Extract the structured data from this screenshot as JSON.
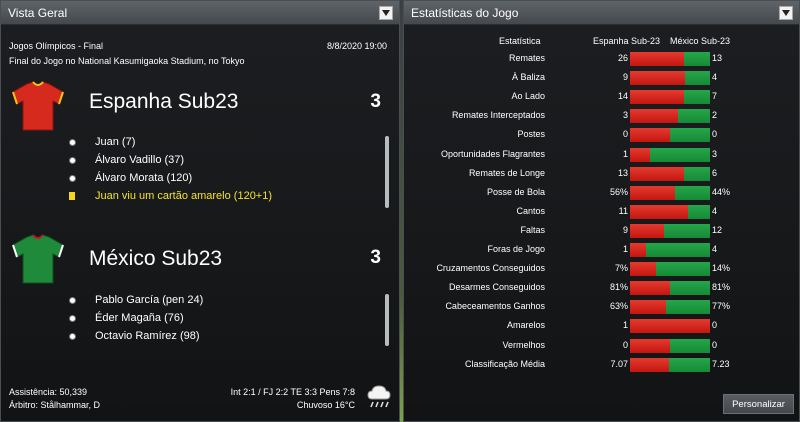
{
  "left_panel": {
    "title": "Vista Geral",
    "competition": "Jogos Olímpicos - Final",
    "date": "8/8/2020 19:00",
    "venue": "Final do Jogo no National Kasumigaoka Stadium, no Tokyo",
    "home": {
      "name": "Espanha Sub23",
      "score": "3",
      "kit_colors": {
        "primary": "#d62a1e",
        "secondary": "#f0c419"
      },
      "events": [
        {
          "type": "goal",
          "text": "Juan (7)"
        },
        {
          "type": "goal",
          "text": "Álvaro Vadillo (37)"
        },
        {
          "type": "goal",
          "text": "Álvaro Morata (120)"
        },
        {
          "type": "yellow-card",
          "text": "Juan viu um cartão amarelo (120+1)"
        }
      ]
    },
    "away": {
      "name": "México Sub23",
      "score": "3",
      "kit_colors": {
        "primary": "#1f8a3a",
        "secondary": "#c8102e"
      },
      "events": [
        {
          "type": "goal",
          "text": "Pablo García (pen 24)"
        },
        {
          "type": "goal",
          "text": "Éder Magaña (76)"
        },
        {
          "type": "goal",
          "text": "Octavio Ramírez (98)"
        }
      ]
    },
    "attendance": "Assistência: 50,339",
    "referee": "Árbitro: Stålhammar, D",
    "score_summary": "Int 2:1 / FJ 2:2 TE 3:3 Pens 7:8",
    "weather": "Chuvoso 16°C",
    "weather_icon": "rain-cloud-icon"
  },
  "right_panel": {
    "title": "Estatísticas do Jogo",
    "col_stat": "Estatística",
    "col_home": "Espanha Sub-23",
    "col_away": "México Sub-23",
    "colors": {
      "home": "#d32018",
      "away": "#1f9a44"
    },
    "stats": [
      {
        "label": "Remates",
        "home": "26",
        "away": "13",
        "home_share": 0.67
      },
      {
        "label": "À Baliza",
        "home": "9",
        "away": "4",
        "home_share": 0.69
      },
      {
        "label": "Ao Lado",
        "home": "14",
        "away": "7",
        "home_share": 0.67
      },
      {
        "label": "Remates Interceptados",
        "home": "3",
        "away": "2",
        "home_share": 0.6
      },
      {
        "label": "Postes",
        "home": "0",
        "away": "0",
        "home_share": 0.5
      },
      {
        "label": "Oportunidades Flagrantes",
        "home": "1",
        "away": "3",
        "home_share": 0.25
      },
      {
        "label": "Remates de Longe",
        "home": "13",
        "away": "6",
        "home_share": 0.68
      },
      {
        "label": "Posse de Bola",
        "home": "56%",
        "away": "44%",
        "home_share": 0.56
      },
      {
        "label": "Cantos",
        "home": "11",
        "away": "4",
        "home_share": 0.73
      },
      {
        "label": "Faltas",
        "home": "9",
        "away": "12",
        "home_share": 0.43
      },
      {
        "label": "Foras de Jogo",
        "home": "1",
        "away": "4",
        "home_share": 0.2
      },
      {
        "label": "Cruzamentos Conseguidos",
        "home": "7%",
        "away": "14%",
        "home_share": 0.33
      },
      {
        "label": "Desarmes Conseguidos",
        "home": "81%",
        "away": "81%",
        "home_share": 0.5
      },
      {
        "label": "Cabeceamentos Ganhos",
        "home": "63%",
        "away": "77%",
        "home_share": 0.45
      },
      {
        "label": "Amarelos",
        "home": "1",
        "away": "0",
        "home_share": 1.0
      },
      {
        "label": "Vermelhos",
        "home": "0",
        "away": "0",
        "home_share": 0.5
      },
      {
        "label": "Classificação Média",
        "home": "7.07",
        "away": "7.23",
        "home_share": 0.49
      }
    ],
    "customize_label": "Personalizar"
  }
}
